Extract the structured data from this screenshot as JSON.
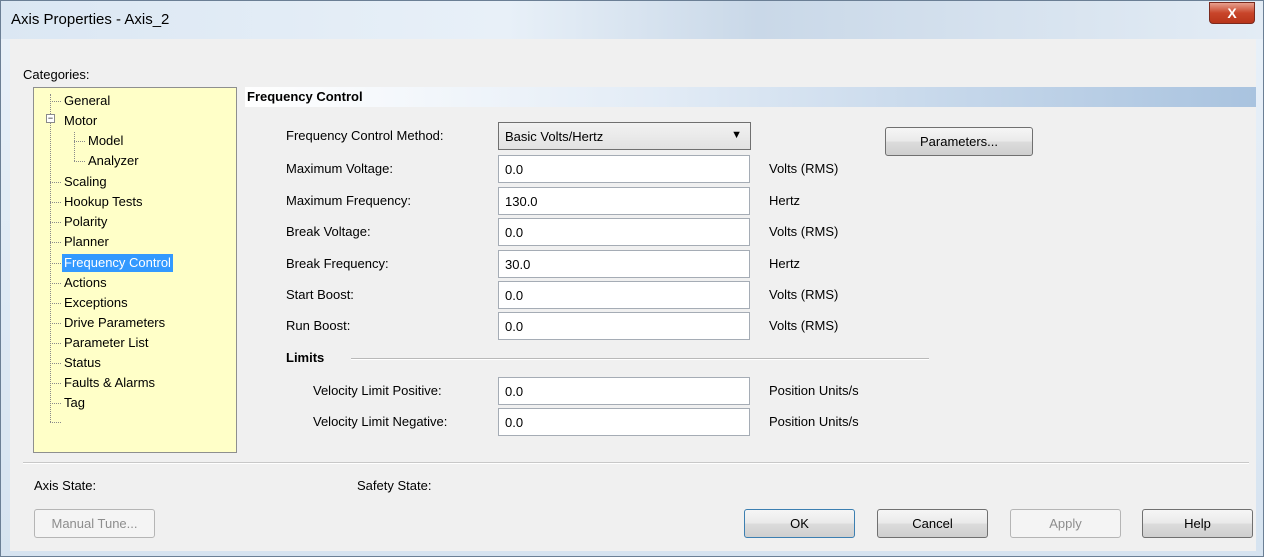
{
  "window": {
    "title": "Axis Properties - Axis_2",
    "close_glyph": "X"
  },
  "categories": {
    "label": "Categories:",
    "items": [
      {
        "label": "General"
      },
      {
        "label": "Motor"
      },
      {
        "label": "Model"
      },
      {
        "label": "Analyzer"
      },
      {
        "label": "Scaling"
      },
      {
        "label": "Hookup Tests"
      },
      {
        "label": "Polarity"
      },
      {
        "label": "Planner"
      },
      {
        "label": "Frequency Control"
      },
      {
        "label": "Actions"
      },
      {
        "label": "Exceptions"
      },
      {
        "label": "Drive Parameters"
      },
      {
        "label": "Parameter List"
      },
      {
        "label": "Status"
      },
      {
        "label": "Faults & Alarms"
      },
      {
        "label": "Tag"
      }
    ],
    "selected": "Frequency Control",
    "expander_glyph": "−"
  },
  "section": {
    "title": "Frequency Control"
  },
  "form": {
    "method_label": "Frequency Control Method:",
    "method_value": "Basic Volts/Hertz",
    "method_arrow": "▼",
    "parameters_button": "Parameters...",
    "fields": [
      {
        "label": "Maximum Voltage:",
        "value": "0.0",
        "unit": "Volts (RMS)"
      },
      {
        "label": "Maximum Frequency:",
        "value": "130.0",
        "unit": "Hertz"
      },
      {
        "label": "Break Voltage:",
        "value": "0.0",
        "unit": "Volts (RMS)"
      },
      {
        "label": "Break Frequency:",
        "value": "30.0",
        "unit": "Hertz"
      },
      {
        "label": "Start Boost:",
        "value": "0.0",
        "unit": "Volts (RMS)"
      },
      {
        "label": "Run Boost:",
        "value": "0.0",
        "unit": "Volts (RMS)"
      }
    ],
    "limits_title": "Limits",
    "limits": [
      {
        "label": "Velocity Limit Positive:",
        "value": "0.0",
        "unit": "Position Units/s"
      },
      {
        "label": "Velocity Limit Negative:",
        "value": "0.0",
        "unit": "Position Units/s"
      }
    ]
  },
  "status": {
    "axis_state_label": "Axis State:",
    "safety_state_label": "Safety State:"
  },
  "buttons": {
    "manual_tune": "Manual Tune...",
    "ok": "OK",
    "cancel": "Cancel",
    "apply": "Apply",
    "help": "Help"
  },
  "colors": {
    "selection": "#3399ff",
    "tree_background": "#ffffc8",
    "close_button": "#c8452a"
  }
}
